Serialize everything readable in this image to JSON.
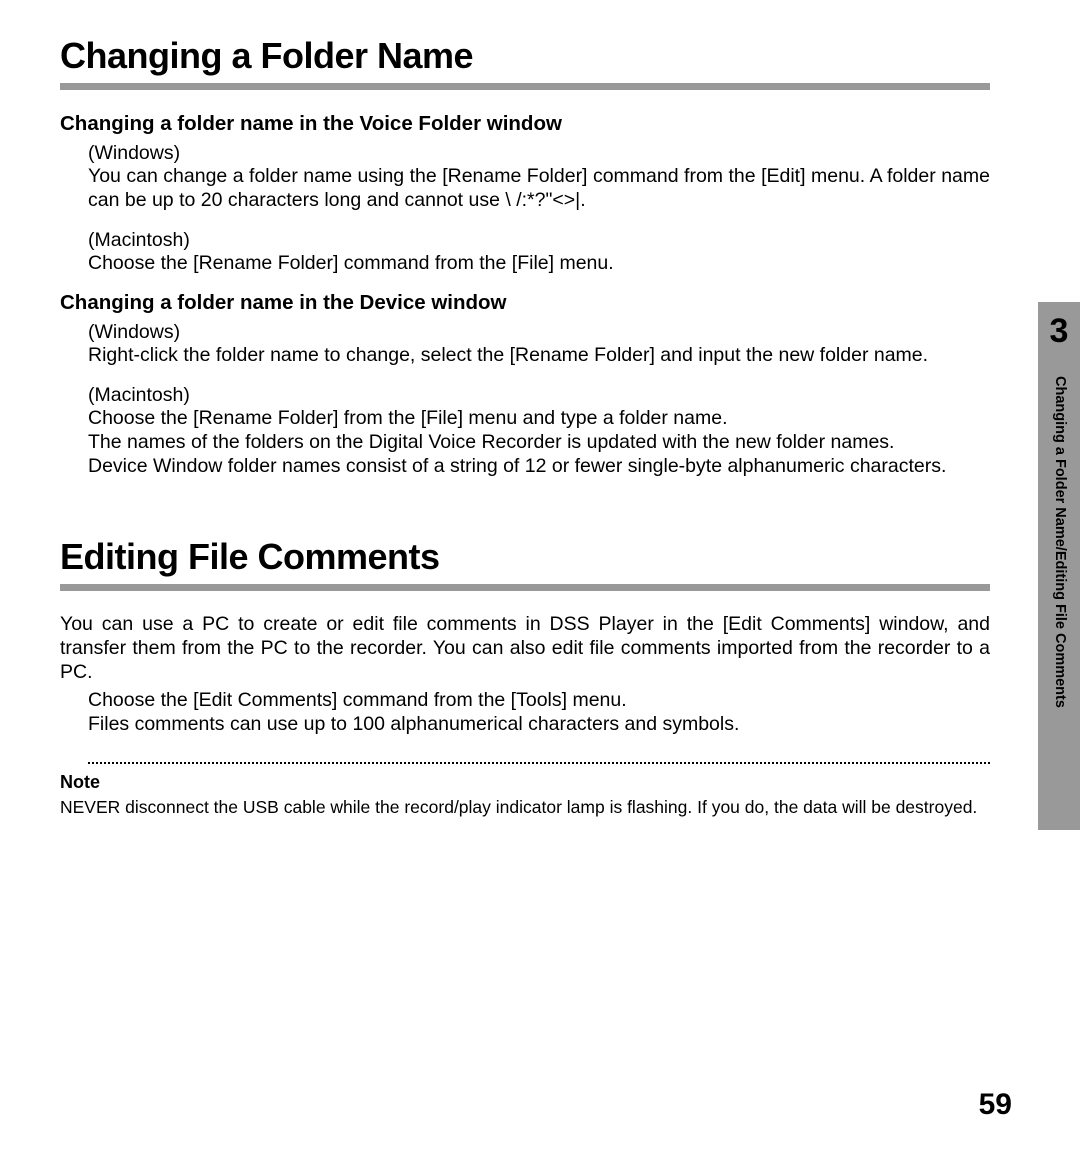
{
  "section1": {
    "title": "Changing a Folder Name",
    "sub1": {
      "heading": "Changing a folder name in the Voice Folder window",
      "win_label": "(Windows)",
      "win_text": "You can change a folder name using the [Rename Folder] command from the [Edit] menu. A folder name can be up to 20 characters long and cannot use \\ /:*?\"<>|.",
      "mac_label": "(Macintosh)",
      "mac_text": "Choose the [Rename Folder] command from the [File] menu."
    },
    "sub2": {
      "heading": "Changing a folder name in the Device window",
      "win_label": "(Windows)",
      "win_text": "Right-click the folder name to change, select the [Rename Folder] and input the new folder name.",
      "mac_label": "(Macintosh)",
      "mac_text1": "Choose the [Rename Folder] from the [File] menu and type a folder name.",
      "mac_text2": "The names of the folders on the Digital Voice Recorder is updated with the new folder names.",
      "mac_text3": "Device Window folder names consist of a string of 12 or fewer single-byte alphanumeric characters."
    }
  },
  "section2": {
    "title": "Editing File Comments",
    "intro": "You can use a PC to create or edit file comments in DSS Player in the [Edit Comments] window, and transfer them from the PC to the recorder. You can also edit file comments imported from the recorder to a PC.",
    "line1": "Choose the [Edit Comments] command from the [Tools] menu.",
    "line2": "Files comments can use up to 100 alphanumerical characters and symbols.",
    "note_head": "Note",
    "note_body": "NEVER disconnect the USB cable while the record/play indicator lamp is flashing. If you do, the data will be destroyed."
  },
  "tab": {
    "number": "3",
    "text": "Changing a Folder Name/Editing File Comments"
  },
  "page_number": "59"
}
